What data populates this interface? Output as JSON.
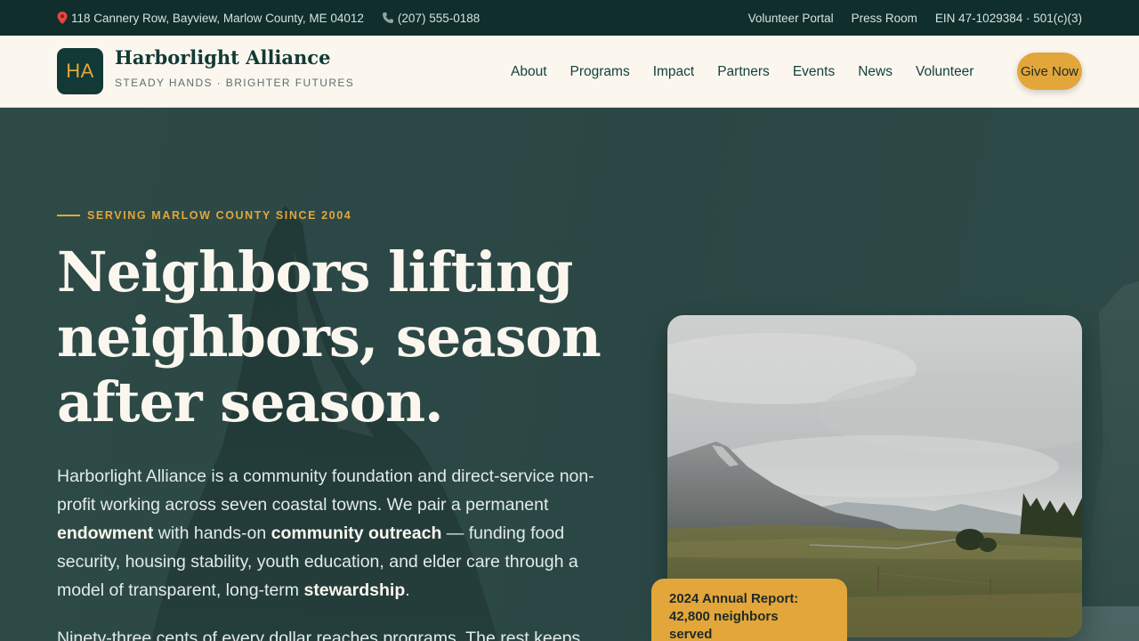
{
  "topbar": {
    "address": "118 Cannery Row, Bayview, Marlow County, ME 04012",
    "phone": "(207) 555-0188",
    "links": [
      "Volunteer Portal",
      "Press Room"
    ],
    "ein": "EIN 47-1029384 · 501(c)(3)"
  },
  "brand": {
    "initials": "HA",
    "name": "Harborlight Alliance",
    "tagline": "STEADY HANDS · BRIGHTER FUTURES"
  },
  "nav": {
    "items": [
      "About",
      "Programs",
      "Impact",
      "Partners",
      "Events",
      "News",
      "Volunteer"
    ],
    "cta": "Give Now"
  },
  "hero": {
    "eyebrow": "SERVING MARLOW COUNTY SINCE 2004",
    "headline_lines": [
      "Neighbors lifting",
      "neighbors, season",
      "after season."
    ],
    "lede": {
      "p1": "Harborlight Alliance is a community foundation and direct-service non-profit working across seven coastal towns. We pair a permanent ",
      "b1": "endowment",
      "p2": " with hands-on ",
      "b2": "community outreach",
      "p3": " — funding food security, housing stability, youth education, and elder care through a model of transparent, long-term ",
      "b3": "stewardship",
      "p4": "."
    },
    "lede2": "Ninety-three cents of every dollar reaches programs. The rest keeps",
    "badge_lines": [
      "2024 Annual Report:",
      "42,800 neighbors",
      "served"
    ]
  },
  "colors": {
    "topbar_bg": "#0f2e2c",
    "header_bg": "#fbf7ef",
    "brand_dark": "#123936",
    "accent": "#e3a63a",
    "hero_bg": "#2b4745"
  }
}
